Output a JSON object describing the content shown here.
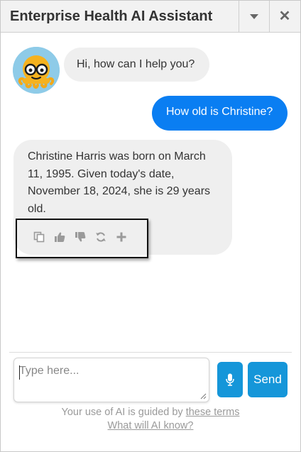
{
  "header": {
    "title": "Enterprise Health AI Assistant",
    "minimize_icon": "caret-down-icon",
    "close_icon": "close-icon"
  },
  "avatar": {
    "icon": "octopus-with-glasses-avatar"
  },
  "messages": {
    "bot_greeting": "Hi, how can I help you?",
    "user_question": "How old is Christine?",
    "bot_answer": "Christine Harris was born on March 11, 1995. Given today's date, November 18, 2024, she is 29 years old."
  },
  "actions": [
    {
      "icon": "copy-icon"
    },
    {
      "icon": "thumbs-up-icon"
    },
    {
      "icon": "thumbs-down-icon"
    },
    {
      "icon": "regenerate-icon"
    },
    {
      "icon": "plus-icon"
    }
  ],
  "composer": {
    "placeholder": "Type here...",
    "value": "",
    "mic_icon": "microphone-icon",
    "send_label": "Send"
  },
  "footer": {
    "notice_prefix": "Your use of AI is guided by",
    "terms_link": "these terms",
    "info_link": "What will AI know?"
  },
  "colors": {
    "user_bubble": "#0a7ef2",
    "bot_bubble": "#efefef",
    "button": "#1596d9",
    "header_bg": "#f2f2f2"
  }
}
